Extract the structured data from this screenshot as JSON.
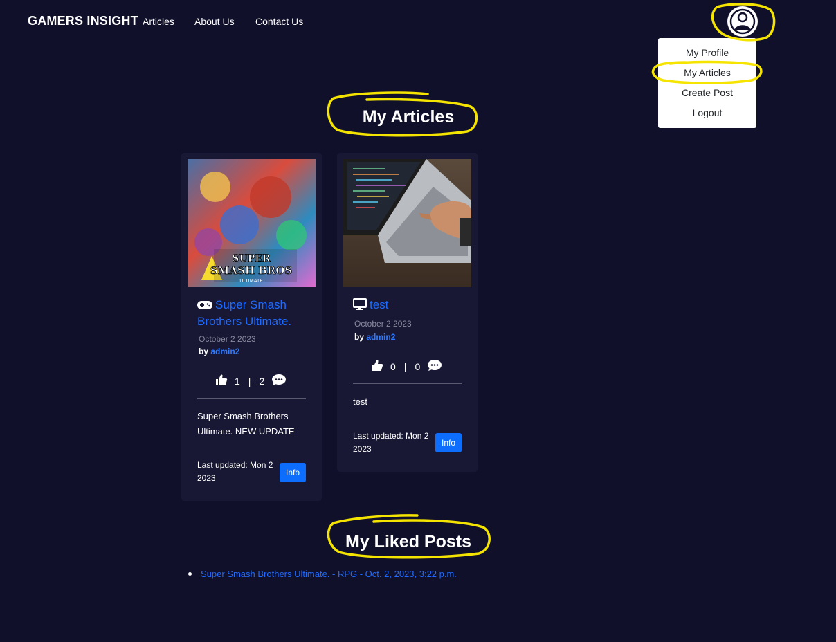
{
  "navbar": {
    "brand": "GAMERS INSIGHT",
    "links": [
      "Articles",
      "About Us",
      "Contact Us"
    ]
  },
  "dropdown": {
    "items": [
      "My Profile",
      "My Articles",
      "Create Post",
      "Logout"
    ]
  },
  "sections": {
    "my_articles": "My Articles",
    "my_liked_posts": "My Liked Posts"
  },
  "articles": [
    {
      "title": "Super Smash Brothers Ultimate.",
      "category_icon": "gamepad-icon",
      "date": "October 2 2023",
      "by_label": "by",
      "author": "admin2",
      "likes": "1",
      "separator": "|",
      "comments": "2",
      "description": "Super Smash Brothers Ultimate. NEW UPDATE",
      "updated": "Last updated: Mon 2 2023",
      "button": "Info",
      "image": "smash-bros-cover"
    },
    {
      "title": "test",
      "category_icon": "monitor-icon",
      "date": "October 2 2023",
      "by_label": "by",
      "author": "admin2",
      "likes": "0",
      "separator": "|",
      "comments": "0",
      "description": "test",
      "updated": "Last updated: Mon 2 2023",
      "button": "Info",
      "image": "laptop-typing-photo"
    }
  ],
  "liked_posts": [
    "Super Smash Brothers Ultimate. - RPG - Oct. 2, 2023, 3:22 p.m."
  ],
  "colors": {
    "background": "#10102b",
    "card": "#181834",
    "link": "#1f6bff",
    "button": "#0d6efd",
    "annotation": "#f5e400"
  }
}
